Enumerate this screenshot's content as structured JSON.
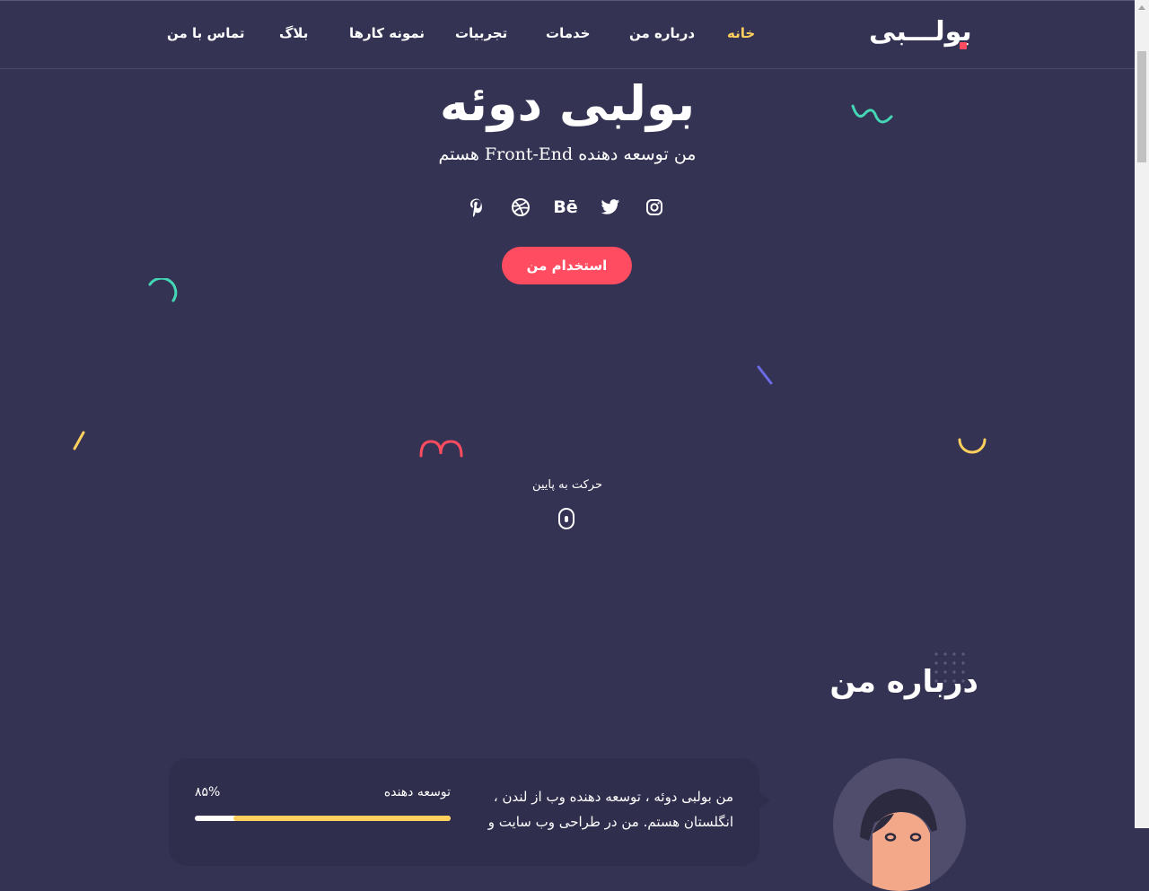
{
  "header": {
    "logo": "بولـــبی",
    "nav": [
      {
        "label": "خانه",
        "active": true
      },
      {
        "label": "درباره من",
        "active": false
      },
      {
        "label": "خدمات",
        "active": false
      },
      {
        "label": "تجربیات",
        "active": false
      },
      {
        "label": "نمونه کارها",
        "active": false
      },
      {
        "label": "بلاگ",
        "active": false
      },
      {
        "label": "تماس با من",
        "active": false
      }
    ]
  },
  "hero": {
    "name": "بولبی دوئه",
    "subtitle": "من توسعه دهنده Front-End هستم",
    "socials": [
      "instagram-icon",
      "twitter-icon",
      "behance-icon",
      "dribbble-icon",
      "pinterest-icon"
    ],
    "cta": "استخدام من",
    "scroll_label": "حرکت به پایین"
  },
  "about": {
    "title": "درباره من",
    "bio": "من بولبی دوئه ، توسعه دهنده وب از لندن ، انگلستان هستم. من در طراحی وب سایت و",
    "skill": {
      "name": "توسعه دهنده",
      "percent_label": "۸۵%",
      "value": 0.85
    }
  },
  "colors": {
    "background": "#353353",
    "accent": "#ff4c60",
    "active_nav": "#ffd15c",
    "teal": "#44d7b6",
    "purple": "#6c6ce5",
    "yellow": "#ffd15c"
  }
}
